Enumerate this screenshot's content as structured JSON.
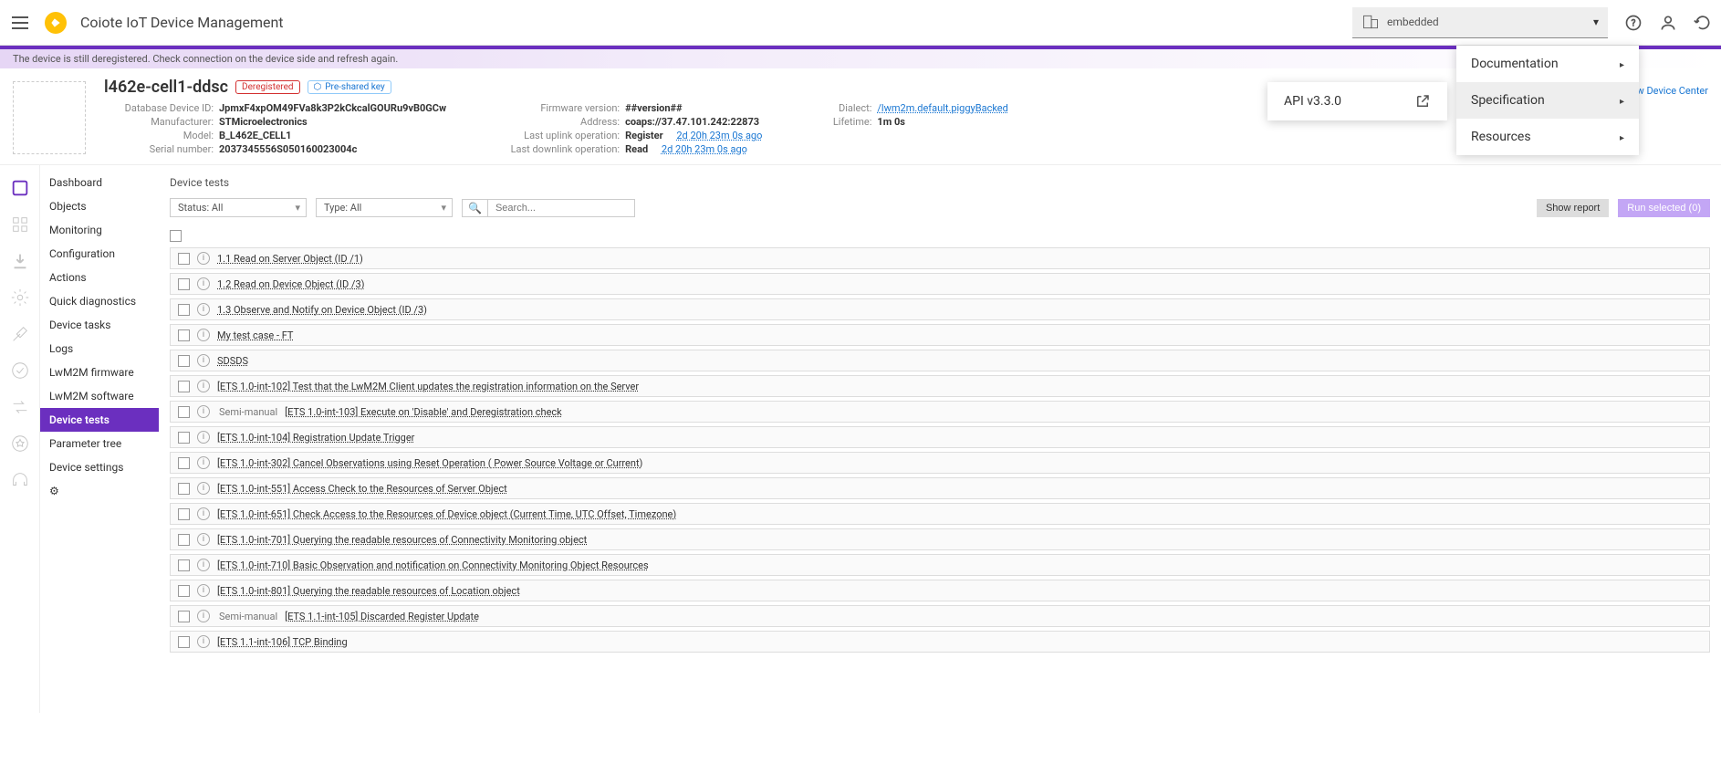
{
  "header": {
    "app_title": "Coiote IoT Device Management",
    "org_name": "embedded"
  },
  "notice": "The device is still deregistered. Check connection on the device side and refresh again.",
  "device": {
    "name": "l462e-cell1-ddsc",
    "badge_dereg": "Deregistered",
    "badge_psk": "Pre-shared key",
    "col1": {
      "db_id_label": "Database Device ID:",
      "db_id": "JpmxF4xpOM49FVa8k3P2kCkcalGOURu9vB0GCw",
      "manufacturer_label": "Manufacturer:",
      "manufacturer": "STMicroelectronics",
      "model_label": "Model:",
      "model": "B_L462E_CELL1",
      "serial_label": "Serial number:",
      "serial": "2037345556S050160023004c"
    },
    "col2": {
      "fw_label": "Firmware version:",
      "fw": "##version##",
      "addr_label": "Address:",
      "addr": "coaps://37.47.101.242:22873",
      "up_label": "Last uplink operation:",
      "up_op": "Register",
      "up_time": "2d 20h 23m 0s ago",
      "down_label": "Last downlink operation:",
      "down_op": "Read",
      "down_time": "2d 20h 23m 0s ago"
    },
    "col3": {
      "dialect_label": "Dialect:",
      "dialect": "/lwm2m.default.piggyBacked",
      "lifetime_label": "Lifetime:",
      "lifetime": "1m 0s"
    },
    "new_device_center": "new Device Center"
  },
  "sidebar": {
    "items": [
      "Dashboard",
      "Objects",
      "Monitoring",
      "Configuration",
      "Actions",
      "Quick diagnostics",
      "Device tasks",
      "Logs",
      "LwM2M firmware",
      "LwM2M software",
      "Device tests",
      "Parameter tree",
      "Device settings"
    ],
    "active_index": 10
  },
  "main": {
    "title": "Device tests",
    "status_filter": "Status: All",
    "type_filter": "Type: All",
    "search_placeholder": "Search...",
    "show_report": "Show report",
    "run_selected": "Run selected (0)",
    "tests": [
      {
        "semi": "",
        "name": "1.1 Read on Server Object (ID /1)"
      },
      {
        "semi": "",
        "name": "1.2 Read on Device Object (ID /3)"
      },
      {
        "semi": "",
        "name": "1.3 Observe and Notify on Device Object (ID /3)"
      },
      {
        "semi": "",
        "name": "My test case - FT"
      },
      {
        "semi": "",
        "name": "SDSDS"
      },
      {
        "semi": "",
        "name": "[ETS 1.0-int-102] Test that the LwM2M Client updates the registration information on the Server"
      },
      {
        "semi": "Semi-manual",
        "name": "[ETS 1.0-int-103] Execute on 'Disable' and Deregistration check"
      },
      {
        "semi": "",
        "name": "[ETS 1.0-int-104] Registration Update Trigger"
      },
      {
        "semi": "",
        "name": "[ETS 1.0-int-302] Cancel Observations using Reset Operation ( Power Source Voltage or Current)"
      },
      {
        "semi": "",
        "name": "[ETS 1.0-int-551] Access Check to the Resources of Server Object"
      },
      {
        "semi": "",
        "name": "[ETS 1.0-int-651] Check Access to the Resources of Device object (Current Time, UTC Offset, Timezone)"
      },
      {
        "semi": "",
        "name": "[ETS 1.0-int-701] Querying the readable resources of Connectivity Monitoring object"
      },
      {
        "semi": "",
        "name": "[ETS 1.0-int-710] Basic Observation and notification on Connectivity Monitoring Object Resources"
      },
      {
        "semi": "",
        "name": "[ETS 1.0-int-801] Querying the readable resources of Location object"
      },
      {
        "semi": "Semi-manual",
        "name": "[ETS 1.1-int-105] Discarded Register Update"
      },
      {
        "semi": "",
        "name": "[ETS 1.1-int-106] TCP Binding"
      }
    ]
  },
  "popup": {
    "api_version": "API v3.3.0"
  },
  "help_menu": {
    "documentation": "Documentation",
    "specification": "Specification",
    "resources": "Resources"
  }
}
